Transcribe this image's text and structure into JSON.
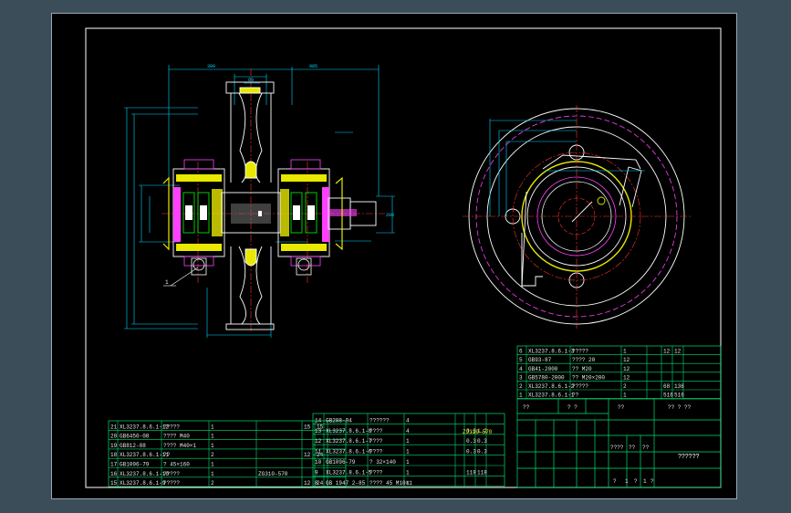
{
  "colors": {
    "background": "#3c4d5a",
    "sheet": "#000000",
    "frame": "#ffffff",
    "table_lines": "#00e070",
    "outline": "#ffffff",
    "center_line": "#ff3030",
    "hidden_line": "#ff40ff",
    "dimension": "#00ffff",
    "part_fill": "#e8e800",
    "green_part": "#00ff00"
  },
  "dims_left": {
    "top_a": "300",
    "top_b": "985",
    "hub": "60",
    "right_v": "200"
  },
  "balloons": {
    "left": "1"
  },
  "bom_left": {
    "rows": [
      {
        "no": "21",
        "code": "XL3237.8.6.1-12",
        "name": "?????",
        "qty": "1",
        "mat": "",
        "w1": "15",
        "w2": "15"
      },
      {
        "no": "20",
        "code": "GB6450-08",
        "name": "???? M40",
        "qty": "1",
        "mat": "",
        "w1": "",
        "w2": ""
      },
      {
        "no": "19",
        "code": "GB812-88",
        "name": "???? M40×1",
        "qty": "1",
        "mat": "",
        "w1": "",
        "w2": ""
      },
      {
        "no": "18",
        "code": "XL3237.8.6.1-11",
        "name": "??",
        "qty": "2",
        "mat": "",
        "w1": "12",
        "w2": "24"
      },
      {
        "no": "17",
        "code": "GB1096-79",
        "name": "? 45×160",
        "qty": "1",
        "mat": "",
        "w1": "",
        "w2": ""
      },
      {
        "no": "16",
        "code": "XL3237.8.6.1-10",
        "name": "?????",
        "qty": "1",
        "mat": "ZG310-570",
        "w1": "",
        "w2": ""
      },
      {
        "no": "15",
        "code": "XL3237.8.6.1-9",
        "name": "?????",
        "qty": "2",
        "mat": "",
        "w1": "12",
        "w2": "24"
      }
    ]
  },
  "bom_mid": {
    "rows": [
      {
        "no": "14",
        "code": "GB288-94",
        "name": "??????",
        "qty": "4",
        "mat": "",
        "w1": "",
        "w2": ""
      },
      {
        "no": "13",
        "code": "XL3237.8.6.1-8",
        "name": "????",
        "qty": "4",
        "mat": "",
        "w1": "0.3",
        "w2": "1.2"
      },
      {
        "no": "12",
        "code": "XL3237.8.6.1-7",
        "name": "????",
        "qty": "1",
        "mat": "",
        "w1": "0.3",
        "w2": "0.3"
      },
      {
        "no": "11",
        "code": "XL3237.8.6.1-6",
        "name": "????",
        "qty": "1",
        "mat": "",
        "w1": "0.3",
        "w2": "0.3"
      },
      {
        "no": "10",
        "code": "GB1096-79",
        "name": "? 32×140",
        "qty": "1",
        "mat": "",
        "w1": "",
        "w2": ""
      },
      {
        "no": "9",
        "code": "XL3237.8.6.1-5",
        "name": "????",
        "qty": "1",
        "mat": "",
        "w1": "118",
        "w2": "118"
      },
      {
        "no": "8",
        "code": "GB 1947 2-85",
        "name": "???? 45 M10×1",
        "qty": "1",
        "mat": "",
        "w1": "",
        "w2": ""
      }
    ],
    "extra": "ZJ310-570"
  },
  "bom_right": {
    "rows": [
      {
        "no": "6",
        "code": "XL3237.8.6.1-3",
        "name": "?????",
        "qty": "1",
        "mat": "",
        "w1": "12",
        "w2": "12"
      },
      {
        "no": "5",
        "code": "GB93-87",
        "name": "???? 20",
        "qty": "12",
        "mat": "",
        "w1": "",
        "w2": ""
      },
      {
        "no": "4",
        "code": "GB41-2000",
        "name": "?? M20",
        "qty": "12",
        "mat": "",
        "w1": "",
        "w2": ""
      },
      {
        "no": "3",
        "code": "GB5780-2000",
        "name": "?? M20×200",
        "qty": "12",
        "mat": "",
        "w1": "",
        "w2": ""
      },
      {
        "no": "2",
        "code": "XL3237.8.6.1-2",
        "name": "?????",
        "qty": "2",
        "mat": "",
        "w1": "68",
        "w2": "136"
      },
      {
        "no": "1",
        "code": "XL3237.8.6.1-1",
        "name": "??",
        "qty": "1",
        "mat": "",
        "w1": "516",
        "w2": "516"
      }
    ],
    "header": {
      "seq": "??",
      "name": "? ?",
      "material": "??",
      "unit_total": "?? ? ??"
    }
  },
  "title_block": {
    "title": "??????",
    "stage_label": "????",
    "weight_label": "??",
    "scale_label": "??",
    "sheet_a": "?",
    "sheet_b": "?",
    "sheet_c": "?",
    "sheet_num": "1",
    "sheet_total": "1"
  }
}
